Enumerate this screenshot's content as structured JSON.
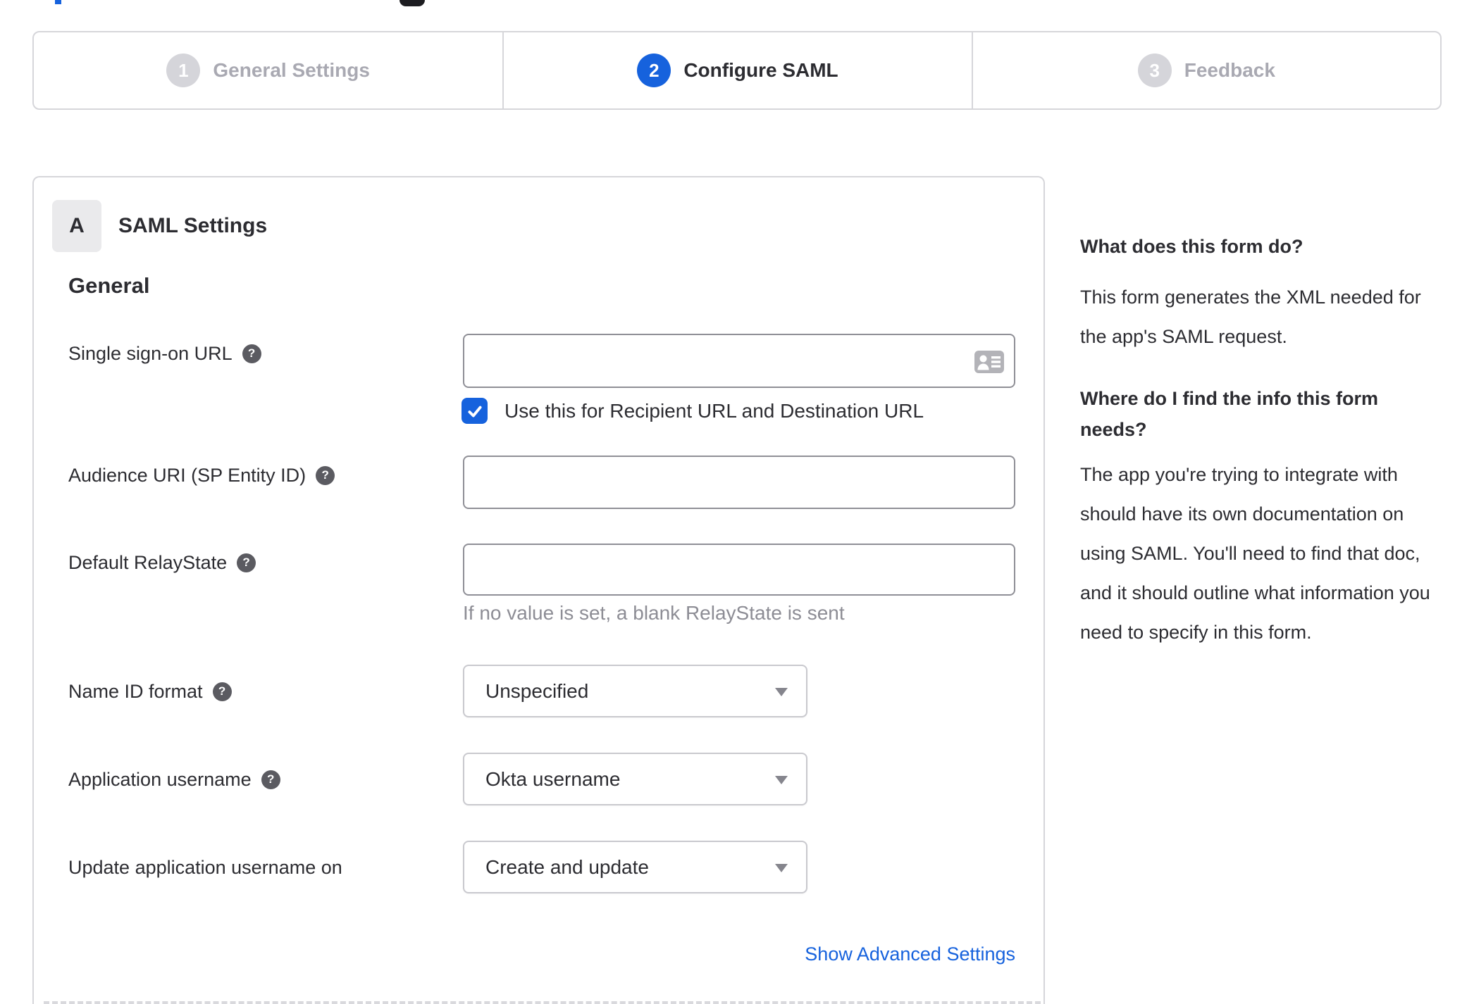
{
  "colors": {
    "accent_blue": "#1662dd",
    "inactive_gray": "#d5d5da",
    "text_dark": "#2c2c31",
    "text_muted": "#8d8d95"
  },
  "stepper": {
    "steps": [
      {
        "number": "1",
        "label": "General Settings",
        "state": "inactive"
      },
      {
        "number": "2",
        "label": "Configure SAML",
        "state": "active"
      },
      {
        "number": "3",
        "label": "Feedback",
        "state": "inactive"
      }
    ]
  },
  "saml_settings": {
    "section_badge": "A",
    "section_title": "SAML Settings",
    "group_title": "General",
    "fields": {
      "sso_url": {
        "label": "Single sign-on URL",
        "value": "",
        "has_help": true,
        "checkbox_label": "Use this for Recipient URL and Destination URL",
        "checkbox_checked": true
      },
      "audience_uri": {
        "label": "Audience URI (SP Entity ID)",
        "value": "",
        "has_help": true
      },
      "default_relay_state": {
        "label": "Default RelayState",
        "value": "",
        "has_help": true,
        "hint": "If no value is set, a blank RelayState is sent"
      },
      "name_id_format": {
        "label": "Name ID format",
        "has_help": true,
        "value": "Unspecified"
      },
      "app_username": {
        "label": "Application username",
        "has_help": true,
        "value": "Okta username"
      },
      "update_app_username": {
        "label": "Update application username on",
        "has_help": false,
        "value": "Create and update"
      }
    },
    "advanced_link_label": "Show Advanced Settings",
    "help_icon_glyph": "?"
  },
  "help_panel": {
    "question_1": "What does this form do?",
    "answer_1": "This form generates the XML needed for the app's SAML request.",
    "question_2": "Where do I find the info this form needs?",
    "answer_2": "The app you're trying to integrate with should have its own documentation on using SAML. You'll need to find that doc, and it should outline what information you need to specify in this form."
  }
}
